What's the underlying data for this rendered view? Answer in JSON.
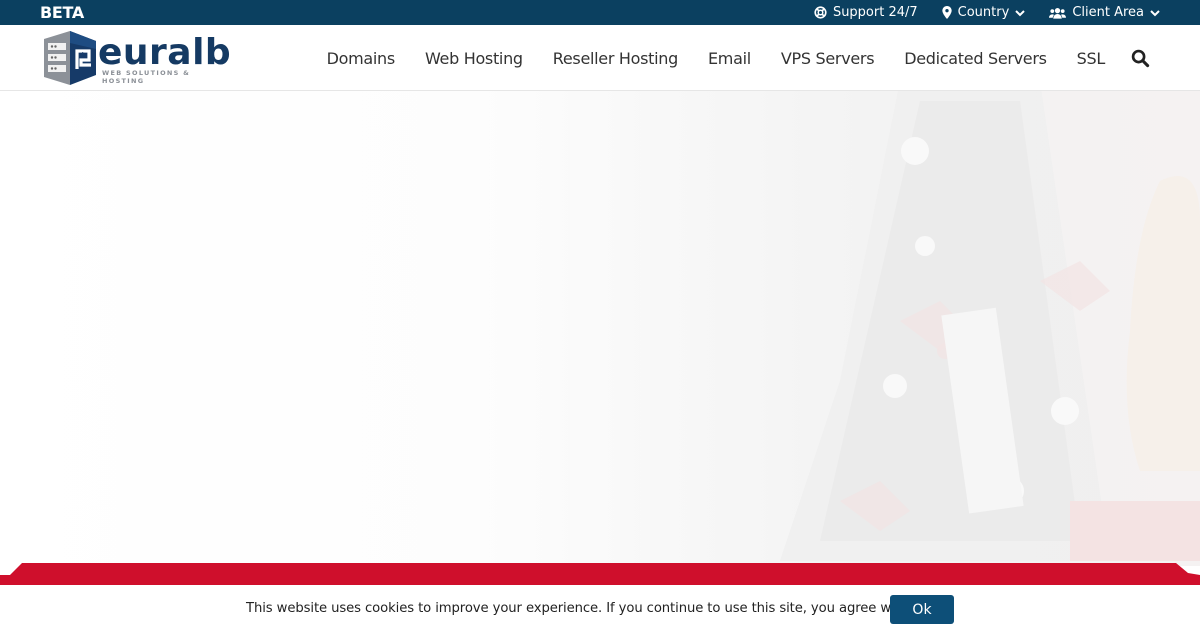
{
  "topbar": {
    "badge": "BETA",
    "links": [
      {
        "label": "Support 24/7",
        "icon": "lifebuoy-icon"
      },
      {
        "label": "Country",
        "icon": "map-marker-icon",
        "dropdown": true
      },
      {
        "label": "Client Area",
        "icon": "users-icon",
        "dropdown": true
      }
    ]
  },
  "header": {
    "logo": {
      "word": "euralb",
      "tagline": "WEB SOLUTIONS & HOSTING"
    },
    "nav": [
      "Domains",
      "Web Hosting",
      "Reseller Hosting",
      "Email",
      "VPS Servers",
      "Dedicated Servers",
      "SSL"
    ],
    "search_icon": "search-icon"
  },
  "colors": {
    "topbar": "#0b4060",
    "brand_navy": "#153a63",
    "accent_red": "#cf0f2c",
    "button": "#0d4f78"
  },
  "cookie": {
    "message": "This website uses cookies to improve your experience. If you continue to use this site, you agree with it.",
    "ok_label": "Ok"
  }
}
